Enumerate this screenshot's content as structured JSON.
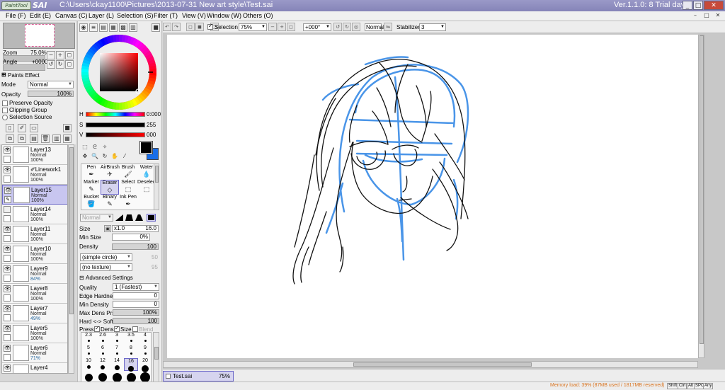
{
  "window": {
    "title": "C:\\Users\\ckay1100\\Pictures\\2013-07-31 New art style\\Test.sai",
    "logo_small": "PaintTool",
    "logo_big": "SAI",
    "version": "Ver.1.1.0: 8 Trial day",
    "minimize": "_",
    "maximize": "□",
    "close": "✕"
  },
  "menu": {
    "items": [
      "File (F)",
      "Edit (E)",
      "Canvas (C)",
      "Layer (L)",
      "Selection (S)",
      "Filter (T)",
      "View (V)",
      "Window (W)",
      "Others (O)"
    ],
    "right_buttons": [
      "–",
      "□",
      "✕"
    ]
  },
  "navigator": {
    "zoom_label": "Zoom",
    "zoom_value": "75.0%",
    "angle_label": "Angle",
    "angle_value": "+0000"
  },
  "layer_props": {
    "paints_effect": "Paints Effect",
    "mode_label": "Mode",
    "mode_value": "Normal",
    "opacity_label": "Opacity",
    "opacity_value": "100%",
    "preserve_opacity": "Preserve Opacity",
    "clipping_group": "Clipping Group",
    "selection_source": "Selection Source"
  },
  "layers": [
    {
      "name": "Layer13",
      "mode": "Normal",
      "opacity": "100%",
      "visible": true,
      "selected": false,
      "icon": ""
    },
    {
      "name": "Linework1",
      "mode": "Normal",
      "opacity": "100%",
      "visible": true,
      "selected": false,
      "icon": "✐"
    },
    {
      "name": "Layer15",
      "mode": "Normal",
      "opacity": "100%",
      "visible": true,
      "selected": true,
      "icon": ""
    },
    {
      "name": "Layer14",
      "mode": "Normal",
      "opacity": "100%",
      "visible": false,
      "selected": false,
      "icon": ""
    },
    {
      "name": "Layer11",
      "mode": "Normal",
      "opacity": "100%",
      "visible": true,
      "selected": false,
      "icon": ""
    },
    {
      "name": "Layer10",
      "mode": "Normal",
      "opacity": "100%",
      "visible": true,
      "selected": false,
      "icon": ""
    },
    {
      "name": "Layer9",
      "mode": "Normal",
      "opacity": "84%",
      "visible": true,
      "selected": false,
      "icon": ""
    },
    {
      "name": "Layer8",
      "mode": "Normal",
      "opacity": "100%",
      "visible": true,
      "selected": false,
      "icon": ""
    },
    {
      "name": "Layer7",
      "mode": "Normal",
      "opacity": "49%",
      "visible": true,
      "selected": false,
      "icon": ""
    },
    {
      "name": "Layer5",
      "mode": "Normal",
      "opacity": "100%",
      "visible": true,
      "selected": false,
      "icon": ""
    },
    {
      "name": "Layer6",
      "mode": "Normal",
      "opacity": "71%",
      "visible": true,
      "selected": false,
      "icon": ""
    },
    {
      "name": "Layer4",
      "mode": "",
      "opacity": "",
      "visible": true,
      "selected": false,
      "icon": ""
    }
  ],
  "color": {
    "h_label": "H",
    "h_value": "0:000",
    "s_label": "S",
    "s_value": "255",
    "v_label": "V",
    "v_value": "000",
    "primary": "#000000",
    "secondary": "#1a6ee8"
  },
  "tools": [
    {
      "label": "Pen",
      "icon": "✒"
    },
    {
      "label": "AirBrush",
      "icon": "✈"
    },
    {
      "label": "Brush",
      "icon": "🖌"
    },
    {
      "label": "Water",
      "icon": "💧"
    },
    {
      "label": "Marker",
      "icon": "✎"
    },
    {
      "label": "Eraser",
      "icon": "◇"
    },
    {
      "label": "Select",
      "icon": "⬚"
    },
    {
      "label": "Deselect",
      "icon": "⬚"
    },
    {
      "label": "Bucket",
      "icon": "🪣"
    },
    {
      "label": "Binary",
      "icon": "✎"
    },
    {
      "label": "Ink Pen",
      "icon": "✒"
    }
  ],
  "tool_settings": {
    "blend_mode": "Normal",
    "size_label": "Size",
    "size_mult": "x1.0",
    "size_value": "16.0",
    "min_size_label": "Min Size",
    "min_size_value": "0%",
    "density_label": "Density",
    "density_value": "100",
    "shape": "(simple circle)",
    "shape_value": "50",
    "texture": "(no texture)",
    "texture_value": "95",
    "advanced_label": "Advanced Settings",
    "quality_label": "Quality",
    "quality_value": "1 (Fastest)",
    "edge_hardness_label": "Edge Hardness",
    "edge_hardness_value": "0",
    "min_density_label": "Min Density",
    "min_density_value": "0",
    "max_dens_label": "Max Dens Prs.",
    "max_dens_value": "100%",
    "hard_soft_label": "Hard <-> Soft",
    "hard_soft_value": "100",
    "press_label": "Press:",
    "press_dens": "Dens",
    "press_size": "Size",
    "press_blend": "Blend"
  },
  "brush_sizes": [
    {
      "label": "2.3",
      "d": 0
    },
    {
      "label": "2.6",
      "d": 0
    },
    {
      "label": "3",
      "d": 0
    },
    {
      "label": "3.5",
      "d": 0
    },
    {
      "label": "4",
      "d": 0
    },
    {
      "label": "5",
      "d": 0
    },
    {
      "label": "6",
      "d": 0
    },
    {
      "label": "7",
      "d": 0
    },
    {
      "label": "8",
      "d": 0
    },
    {
      "label": "9",
      "d": 0
    },
    {
      "label": "10",
      "d": 5
    },
    {
      "label": "12",
      "d": 6
    },
    {
      "label": "14",
      "d": 7
    },
    {
      "label": "16",
      "d": 8
    },
    {
      "label": "20",
      "d": 10
    },
    {
      "label": "",
      "d": 11
    },
    {
      "label": "",
      "d": 12
    },
    {
      "label": "",
      "d": 13
    },
    {
      "label": "",
      "d": 13
    },
    {
      "label": "",
      "d": 14
    }
  ],
  "canvas_toolbar": {
    "selection_label": "Selection",
    "zoom": "75%",
    "angle": "+000°",
    "blend": "Normal",
    "stabilizer_label": "Stabilizer",
    "stabilizer_value": "3"
  },
  "doc_tab": {
    "name": "Test.sai",
    "zoom": "75%"
  },
  "status": {
    "memory": "Memory load: 39% (87MB used / 1817MB reserved)",
    "keys": [
      "Shift",
      "Ctrl",
      "Alt",
      "SPC",
      "Any"
    ]
  }
}
